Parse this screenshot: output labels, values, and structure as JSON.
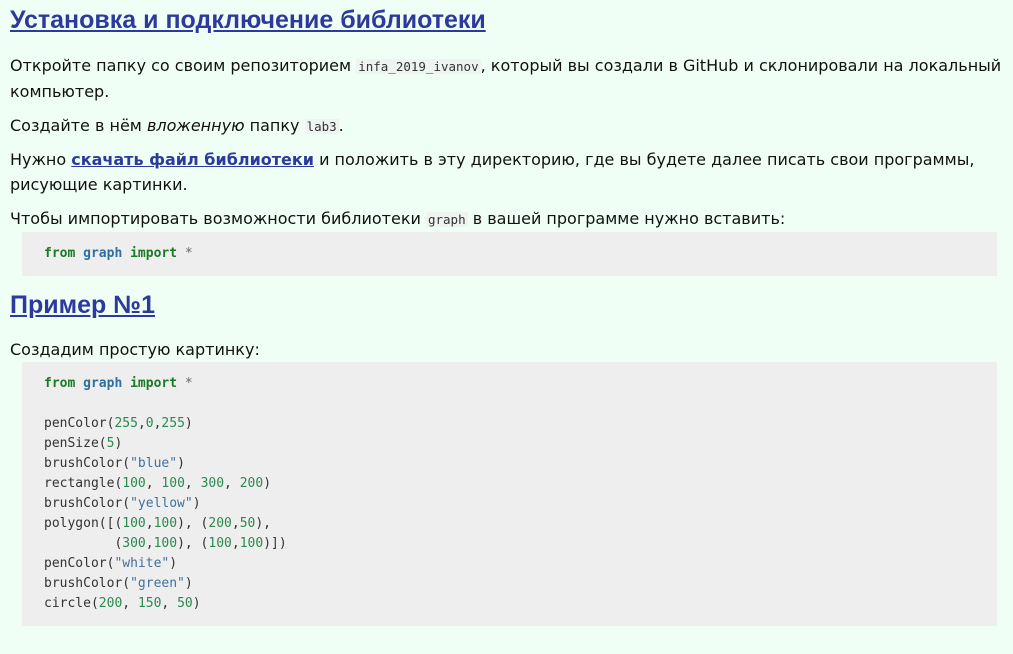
{
  "section1": {
    "heading": "Установка и подключение библиотеки",
    "p1_before": "Откройте папку со своим репозиторием ",
    "p1_code": "infa_2019_ivanov",
    "p1_after": ", который вы создали в GitHub и склонировали на локальный компьютер.",
    "p2_before": "Создайте в нём ",
    "p2_em": "вложенную",
    "p2_middle": " папку ",
    "p2_code": "lab3",
    "p2_after": ".",
    "p3_before": "Нужно ",
    "p3_link": "скачать файл библиотеки",
    "p3_after": " и положить в эту директорию, где вы будете далее писать свои программы, рисующие картинки.",
    "p4_before": "Чтобы импортировать возможности библиотеки ",
    "p4_code": "graph",
    "p4_after": " в вашей программе нужно вставить:",
    "import_code": {
      "kw_from": "from",
      "module": "graph",
      "kw_import": "import",
      "star": "*"
    }
  },
  "section2": {
    "heading": "Пример №1",
    "p1": "Создадим простую картинку:",
    "code_lines": [
      "from graph import *",
      "",
      "penColor(255,0,255)",
      "penSize(5)",
      "brushColor(\"blue\")",
      "rectangle(100, 100, 300, 200)",
      "brushColor(\"yellow\")",
      "polygon([(100,100), (200,50),",
      "         (300,100), (100,100)])",
      "penColor(\"white\")",
      "brushColor(\"green\")",
      "circle(200, 150, 50)"
    ]
  }
}
